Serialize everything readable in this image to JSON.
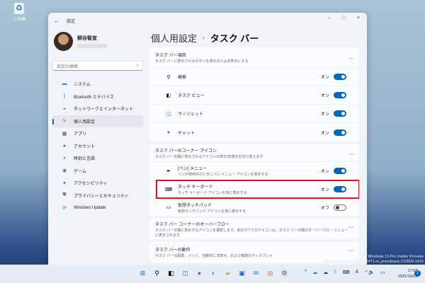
{
  "desktop": {
    "recycle_bin": "ごみ箱",
    "watermark": [
      "Windows 11 Pro Insider Preview",
      "Evaluation copy. Build 22471.rs_prerelease.210929-1415"
    ]
  },
  "window": {
    "title": "設定",
    "controls": {
      "minimize": "–",
      "maximize": "□",
      "close": "×"
    }
  },
  "profile": {
    "name": "柳谷智宣"
  },
  "search": {
    "placeholder": "設定の検索"
  },
  "nav": [
    {
      "label": "システム"
    },
    {
      "label": "Bluetooth とデバイス"
    },
    {
      "label": "ネットワークとインターネット"
    },
    {
      "label": "個人用設定",
      "active": true
    },
    {
      "label": "アプリ"
    },
    {
      "label": "アカウント"
    },
    {
      "label": "時刻と言語"
    },
    {
      "label": "ゲーム"
    },
    {
      "label": "アクセシビリティ"
    },
    {
      "label": "プライバシーとセキュリティ"
    },
    {
      "label": "Windows Update"
    }
  ],
  "breadcrumb": {
    "parent": "個人用設定",
    "current": "タスク バー"
  },
  "sections": [
    {
      "title": "タスク バー項目",
      "subtitle": "タスク バーに表示されるボタンを表示または非表示にする",
      "expanded": true,
      "items": [
        {
          "label": "検索",
          "state": "オン",
          "on": true
        },
        {
          "label": "タスク ビュー",
          "state": "オン",
          "on": true
        },
        {
          "label": "ウィジェット",
          "state": "オン",
          "on": true
        },
        {
          "label": "チャット",
          "state": "オン",
          "on": true
        }
      ]
    },
    {
      "title": "タスク バーのコーナー アイコン",
      "subtitle": "タスク バーの隅に表示されるアイコンの表示/非表示を切り替えます",
      "expanded": true,
      "items": [
        {
          "label": "[ペン] メニュー",
          "sub": "ペンが使用中のときにペン メニュー アイコンを表示する",
          "state": "オン",
          "on": true
        },
        {
          "label": "タッチ キーボード",
          "sub": "タッチ キーボード アイコンを常に表示する",
          "state": "オン",
          "on": true,
          "highlighted": true
        },
        {
          "label": "仮想タッチパッド",
          "sub": "仮想タッチパッド アイコンを常に表示する",
          "state": "オフ",
          "on": false
        }
      ]
    },
    {
      "title": "タスク バー コーナーのオーバーフロー",
      "subtitle": "タスク バーの隅に表示するアイコンを選択します。他のすべてのアイコンは、タスク バーの隅のオーバーフロー メニューに表示されます",
      "expanded": false
    },
    {
      "title": "タスク バーの動作",
      "subtitle": "タスク バーの配置、バッジ、自動的に非表示、および複数のディスプレイ",
      "expanded": false
    }
  ],
  "taskbar": {
    "time": "17:02",
    "date": "2021/10/22",
    "notifications": "1"
  },
  "colors": {
    "accent": "#0067c0",
    "highlight": "#e0141e"
  }
}
